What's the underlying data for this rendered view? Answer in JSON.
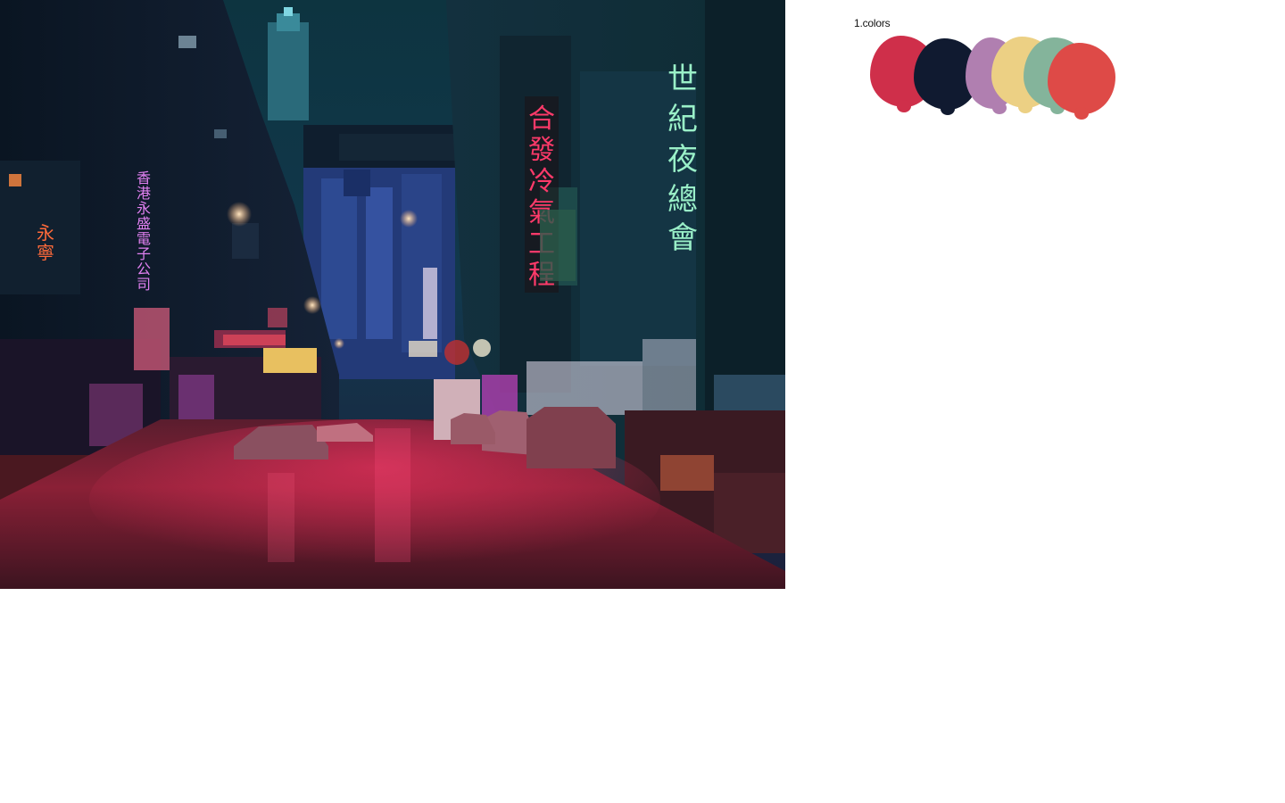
{
  "photo": {
    "description_alt": "",
    "signs": {
      "right_green": [
        "世",
        "紀",
        "夜",
        "總",
        "會"
      ],
      "right_red": [
        "合",
        "發",
        "冷",
        "氣",
        "工",
        "程"
      ],
      "left_purple": [
        "香",
        "港",
        "永",
        "盛",
        "電",
        "子",
        "公",
        "司"
      ],
      "left_orange": [
        "永",
        "寧"
      ]
    }
  },
  "palette": {
    "title": "1.colors",
    "swatches": [
      {
        "name": "crimson",
        "color": "#cf2f4a"
      },
      {
        "name": "navy",
        "color": "#101a30"
      },
      {
        "name": "lilac",
        "color": "#b07fb0"
      },
      {
        "name": "sand",
        "color": "#ecd084"
      },
      {
        "name": "sage",
        "color": "#84b49b"
      },
      {
        "name": "coral",
        "color": "#de4a47"
      }
    ]
  }
}
